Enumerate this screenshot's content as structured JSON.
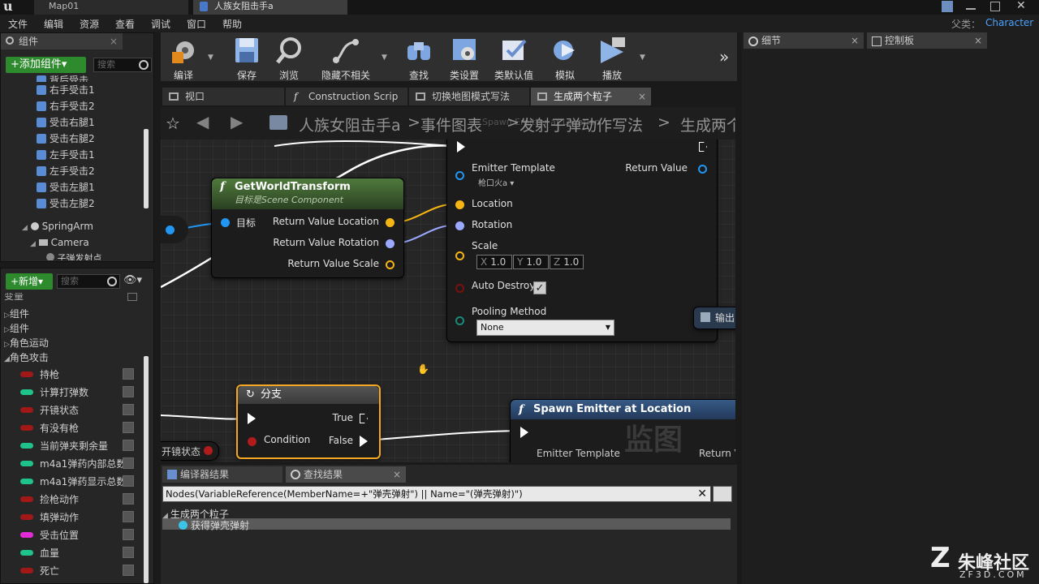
{
  "titlebar": {
    "logo": "u",
    "tabs": [
      {
        "label": "Map01",
        "active": false
      },
      {
        "label": "人族女阻击手a",
        "active": true
      }
    ]
  },
  "menubar": {
    "items": [
      "文件",
      "编辑",
      "资源",
      "查看",
      "调试",
      "窗口",
      "帮助"
    ],
    "parent_label": "父类：",
    "parent_value": "Character"
  },
  "components_panel": {
    "tab": "组件",
    "add_button": "+添加组件▾",
    "search_placeholder": "搜索",
    "items": [
      "背后受击",
      "右手受击1",
      "右手受击2",
      "受击右腿1",
      "受击右腿2",
      "左手受击1",
      "左手受击2",
      "受击左腿1",
      "受击左腿2",
      "SpringArm",
      "Camera",
      "子弹发射点"
    ]
  },
  "mybp_panel": {
    "new_button": "+新增▾",
    "search_placeholder": "搜索",
    "categories": [
      "变量",
      "组件",
      "组件",
      "角色运动",
      "角色攻击"
    ],
    "variables": [
      {
        "name": "持枪",
        "color": "#a01818"
      },
      {
        "name": "计算打弹数",
        "color": "#1fc38a"
      },
      {
        "name": "开镜状态",
        "color": "#a01818"
      },
      {
        "name": "有没有枪",
        "color": "#a01818"
      },
      {
        "name": "当前弹夹剩余量",
        "color": "#1fc38a"
      },
      {
        "name": "m4a1弹药内部总数",
        "color": "#1fc38a"
      },
      {
        "name": "m4a1弹药显示总数",
        "color": "#1fc38a"
      },
      {
        "name": "捡枪动作",
        "color": "#a01818"
      },
      {
        "name": "填弹动作",
        "color": "#a01818"
      },
      {
        "name": "受击位置",
        "color": "#e22bd6"
      },
      {
        "name": "血量",
        "color": "#1fc38a"
      },
      {
        "name": "死亡",
        "color": "#a01818"
      }
    ]
  },
  "toolbar": {
    "buttons": [
      {
        "label": "编译",
        "icon": "compile-icon"
      },
      {
        "label": "保存",
        "icon": "save-icon"
      },
      {
        "label": "浏览",
        "icon": "browse-icon"
      },
      {
        "label": "隐藏不相关",
        "icon": "hide-unrelated-icon"
      },
      {
        "label": "查找",
        "icon": "find-icon"
      },
      {
        "label": "类设置",
        "icon": "class-settings-icon"
      },
      {
        "label": "类默认值",
        "icon": "class-defaults-icon"
      },
      {
        "label": "模拟",
        "icon": "simulate-icon"
      },
      {
        "label": "播放",
        "icon": "play-icon"
      }
    ],
    "overflow": "»"
  },
  "graph_tabs": [
    {
      "label": "视口",
      "active": false
    },
    {
      "label": "Construction Scrip",
      "active": false
    },
    {
      "label": "切换地图模式写法",
      "active": false
    },
    {
      "label": "生成两个粒子",
      "active": true
    }
  ],
  "breadcrumb": {
    "items": [
      "人族女阻击手a",
      "事件图表",
      "发射子弹动作写法",
      "生成两个"
    ],
    "overlay_text": "Spawn Emitter at Location"
  },
  "nodes": {
    "get_world_transform": {
      "title": "GetWorldTransform",
      "subtitle": "目标是Scene Component",
      "target": "目标",
      "outputs": [
        "Return Value Location",
        "Return Value Rotation",
        "Return Value Scale"
      ]
    },
    "spawn_top": {
      "emitter_template": "Emitter Template",
      "emitter_value": "枪口火a ▾",
      "return_value": "Return Value",
      "location": "Location",
      "rotation": "Rotation",
      "scale": "Scale",
      "scale_x": "1.0",
      "scale_y": "1.0",
      "scale_z": "1.0",
      "axis_x": "X",
      "axis_y": "Y",
      "axis_z": "Z",
      "auto_destroy": "Auto Destroy",
      "pooling_method": "Pooling Method",
      "pooling_value": "None"
    },
    "branch": {
      "title": "分支",
      "true_label": "True",
      "false_label": "False",
      "condition": "Condition"
    },
    "spawn_bottom": {
      "title": "Spawn Emitter at Location",
      "watermark": "监图",
      "emitter_template": "Emitter Template",
      "return_value": "Return V"
    },
    "output_node": "输出",
    "var_node": "开镜状态"
  },
  "bottom_panel": {
    "tabs": [
      "编译器结果",
      "查找结果"
    ],
    "search_query": "Nodes(VariableReference(MemberName=+\"弹壳弹射\") || Name=\"(弹壳弹射)\")",
    "results_root": "生成两个粒子",
    "result_item": "获得弹壳弹射"
  },
  "right_panel": {
    "tabs": [
      "细节",
      "控制板"
    ]
  },
  "watermark": {
    "brand": "朱峰社区",
    "url": "ZF3D.COM"
  }
}
